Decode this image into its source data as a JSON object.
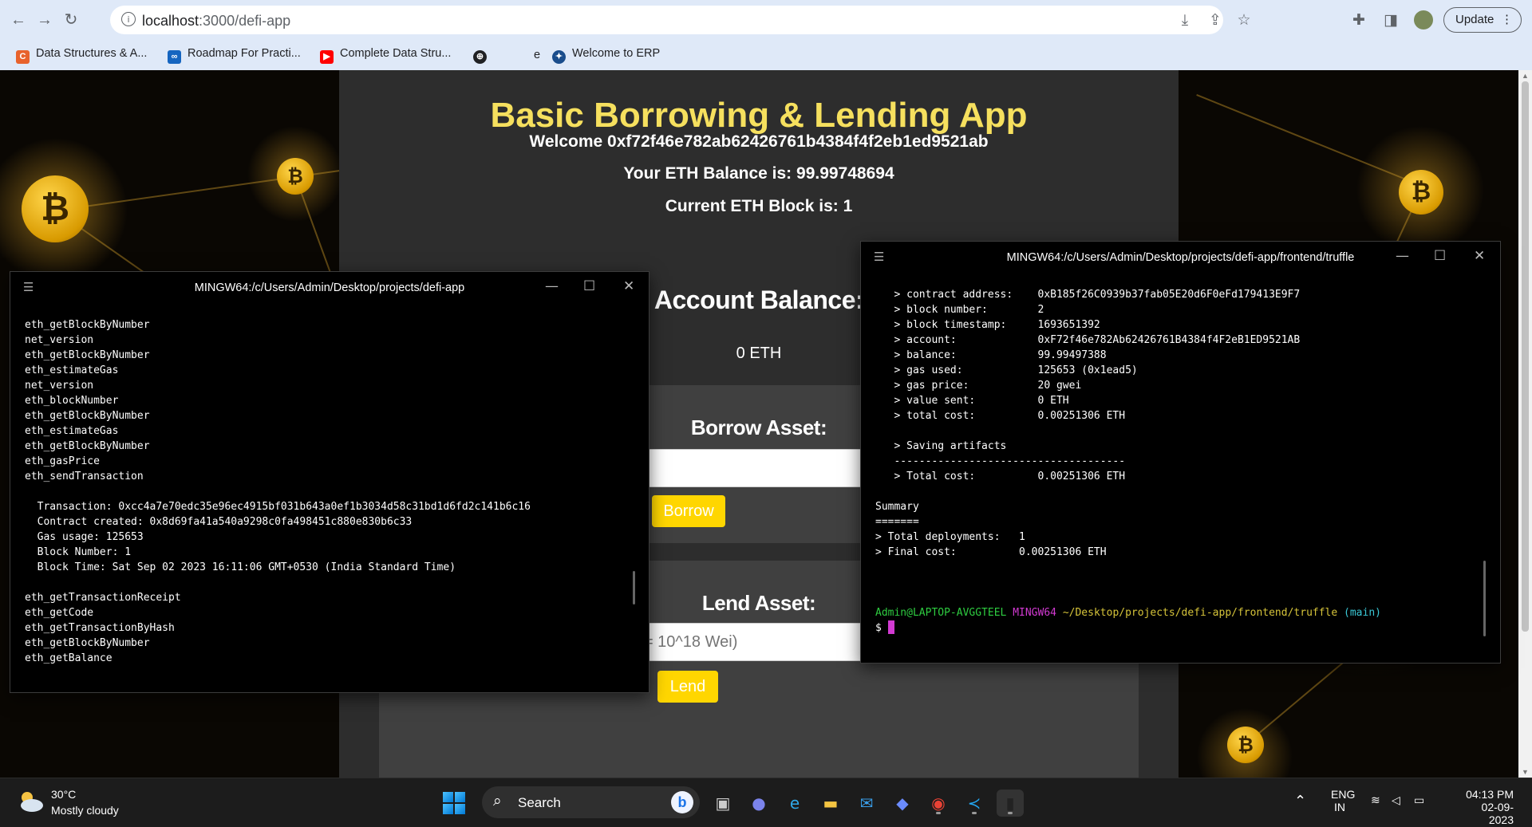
{
  "browser": {
    "url_host": "localhost",
    "url_path": ":3000/defi-app",
    "update_label": "Update",
    "bookmarks": [
      {
        "label": "Data Structures & A...",
        "icon": "codingninjas-icon",
        "color": "#e8622c"
      },
      {
        "label": "Roadmap For Practi...",
        "icon": "link-icon",
        "color": "#1565c0"
      },
      {
        "label": "Complete Data Stru...",
        "icon": "youtube-icon",
        "color": "#ff0000"
      },
      {
        "label": "",
        "icon": "globe-icon",
        "color": "#202124"
      },
      {
        "label": "e",
        "icon": "blank-icon",
        "color": "#dfe9f8"
      },
      {
        "label": "Welcome to ERP",
        "icon": "erp-icon",
        "color": "#1a4d8c"
      }
    ]
  },
  "app": {
    "title": "Basic Borrowing & Lending App",
    "welcome": "Welcome 0xf72f46e782ab62426761b4384f4f2eb1ed9521ab",
    "eth_balance": "Your ETH Balance is: 99.99748694",
    "eth_block": "Current ETH Block is: 1",
    "account_heading": "Account Balance:",
    "account_value": "0 ETH",
    "borrow_title": "Borrow Asset:",
    "borrow_button": "Borrow",
    "lend_title": "Lend Asset:",
    "lend_placeholder": "Amount in Wei (1 Ether = 10^18 Wei)",
    "lend_button": "Lend",
    "colors": {
      "title": "#f6e05e",
      "button": "#ffd600",
      "panel": "#2d2d2d"
    }
  },
  "terminal1": {
    "title": "MINGW64:/c/Users/Admin/Desktop/projects/defi-app",
    "lines": [
      "eth_getBlockByNumber",
      "net_version",
      "eth_getBlockByNumber",
      "eth_estimateGas",
      "net_version",
      "eth_blockNumber",
      "eth_getBlockByNumber",
      "eth_estimateGas",
      "eth_getBlockByNumber",
      "eth_gasPrice",
      "eth_sendTransaction",
      "",
      "  Transaction: 0xcc4a7e70edc35e96ec4915bf031b643a0ef1b3034d58c31bd1d6fd2c141b6c16",
      "  Contract created: 0x8d69fa41a540a9298c0fa498451c880e830b6c33",
      "  Gas usage: 125653",
      "  Block Number: 1",
      "  Block Time: Sat Sep 02 2023 16:11:06 GMT+0530 (India Standard Time)",
      "",
      "eth_getTransactionReceipt",
      "eth_getCode",
      "eth_getTransactionByHash",
      "eth_getBlockByNumber",
      "eth_getBalance"
    ]
  },
  "terminal2": {
    "title": "MINGW64:/c/Users/Admin/Desktop/projects/defi-app/frontend/truffle",
    "lines": [
      "   > contract address:    0xB185f26C0939b37fab05E20d6F0eFd179413E9F7",
      "   > block number:        2",
      "   > block timestamp:     1693651392",
      "   > account:             0xF72f46e782Ab62426761B4384f4F2eB1ED9521AB",
      "   > balance:             99.99497388",
      "   > gas used:            125653 (0x1ead5)",
      "   > gas price:           20 gwei",
      "   > value sent:          0 ETH",
      "   > total cost:          0.00251306 ETH",
      "",
      "   > Saving artifacts",
      "   -------------------------------------",
      "   > Total cost:          0.00251306 ETH",
      "",
      "Summary",
      "=======",
      "> Total deployments:   1",
      "> Final cost:          0.00251306 ETH",
      "",
      "",
      ""
    ],
    "prompt_user": "Admin@LAPTOP-AVGGTEEL",
    "prompt_shell": "MINGW64",
    "prompt_path": "~/Desktop/projects/defi-app/frontend/truffle",
    "prompt_branch": "(main)",
    "prompt_symbol": "$"
  },
  "taskbar": {
    "temperature": "30°C",
    "condition": "Mostly cloudy",
    "search_label": "Search",
    "language": "ENG",
    "region": "IN",
    "time": "04:13 PM",
    "date": "02-09-2023",
    "apps": [
      {
        "name": "task-view-icon",
        "glyph": "▣"
      },
      {
        "name": "teams-icon",
        "glyph": "●"
      },
      {
        "name": "edge-icon",
        "glyph": "e"
      },
      {
        "name": "file-explorer-icon",
        "glyph": "▬"
      },
      {
        "name": "mail-icon",
        "glyph": "✉"
      },
      {
        "name": "copilot-icon",
        "glyph": "◆"
      },
      {
        "name": "chrome-icon",
        "glyph": "◉"
      },
      {
        "name": "vscode-icon",
        "glyph": "≺"
      },
      {
        "name": "terminal-icon",
        "glyph": "▮"
      }
    ]
  }
}
